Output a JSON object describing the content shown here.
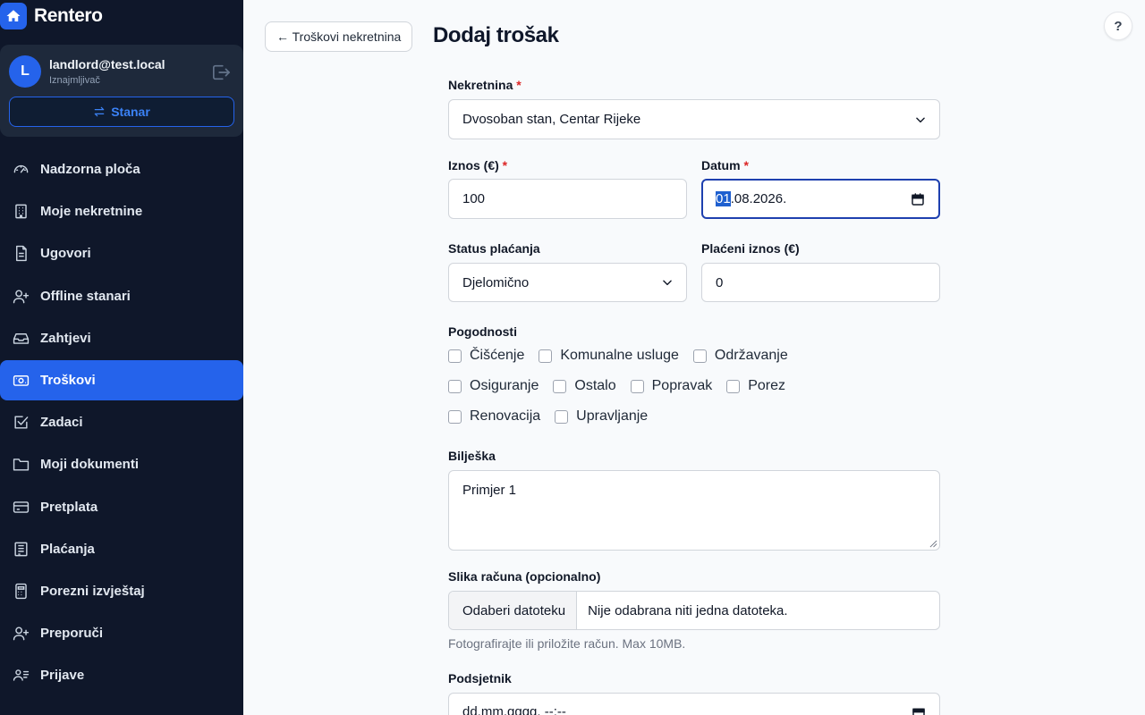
{
  "app": {
    "name": "Rentero"
  },
  "user": {
    "initial": "L",
    "email": "landlord@test.local",
    "role": "Iznajmljivač",
    "switch_label": "Stanar"
  },
  "nav": [
    {
      "id": "dashboard",
      "label": "Nadzorna ploča",
      "icon": "gauge-icon"
    },
    {
      "id": "properties",
      "label": "Moje nekretnine",
      "icon": "building-icon"
    },
    {
      "id": "contracts",
      "label": "Ugovori",
      "icon": "document-icon"
    },
    {
      "id": "offline-tenants",
      "label": "Offline stanari",
      "icon": "user-plus-icon"
    },
    {
      "id": "requests",
      "label": "Zahtjevi",
      "icon": "inbox-icon"
    },
    {
      "id": "expenses",
      "label": "Troškovi",
      "icon": "money-icon",
      "active": true
    },
    {
      "id": "tasks",
      "label": "Zadaci",
      "icon": "checkbox-icon"
    },
    {
      "id": "documents",
      "label": "Moji dokumenti",
      "icon": "folder-icon"
    },
    {
      "id": "subscription",
      "label": "Pretplata",
      "icon": "credit-card-icon"
    },
    {
      "id": "payments",
      "label": "Plaćanja",
      "icon": "ledger-icon"
    },
    {
      "id": "tax-report",
      "label": "Porezni izvještaj",
      "icon": "calculator-icon"
    },
    {
      "id": "referrals",
      "label": "Preporuči",
      "icon": "user-plus-icon"
    },
    {
      "id": "applications",
      "label": "Prijave",
      "icon": "id-card-icon"
    }
  ],
  "header": {
    "back_label": "← Troškovi nekretnina",
    "title": "Dodaj trošak",
    "help": "?"
  },
  "form": {
    "property": {
      "label": "Nekretnina",
      "required_mark": "*",
      "value": "Dvosoban stan, Centar Rijeke"
    },
    "amount": {
      "label": "Iznos (€)",
      "required_mark": "*",
      "value": "100"
    },
    "date": {
      "label": "Datum",
      "required_mark": "*",
      "value_selected": "01",
      "value_rest": ".08.2026."
    },
    "payment_status": {
      "label": "Status plaćanja",
      "value": "Djelomično"
    },
    "paid_amount": {
      "label": "Plaćeni iznos (€)",
      "value": "0"
    },
    "categories_label": "Pogodnosti",
    "categories": [
      [
        "Čišćenje",
        "Komunalne usluge",
        "Održavanje"
      ],
      [
        "Osiguranje",
        "Ostalo",
        "Popravak",
        "Porez"
      ],
      [
        "Renovacija",
        "Upravljanje"
      ]
    ],
    "note": {
      "label": "Bilješka",
      "value": "Primjer 1"
    },
    "receipt": {
      "label": "Slika računa (opcionalno)",
      "button": "Odaberi datoteku",
      "status": "Nije odabrana niti jedna datoteka.",
      "hint": "Fotografirajte ili priložite račun. Max 10MB."
    },
    "reminder": {
      "label": "Podsjetnik",
      "placeholder": "dd.mm.gggg. --:--"
    }
  },
  "colors": {
    "sidebar": "#0f172a",
    "accent": "#2563eb",
    "required": "#dc2626"
  }
}
